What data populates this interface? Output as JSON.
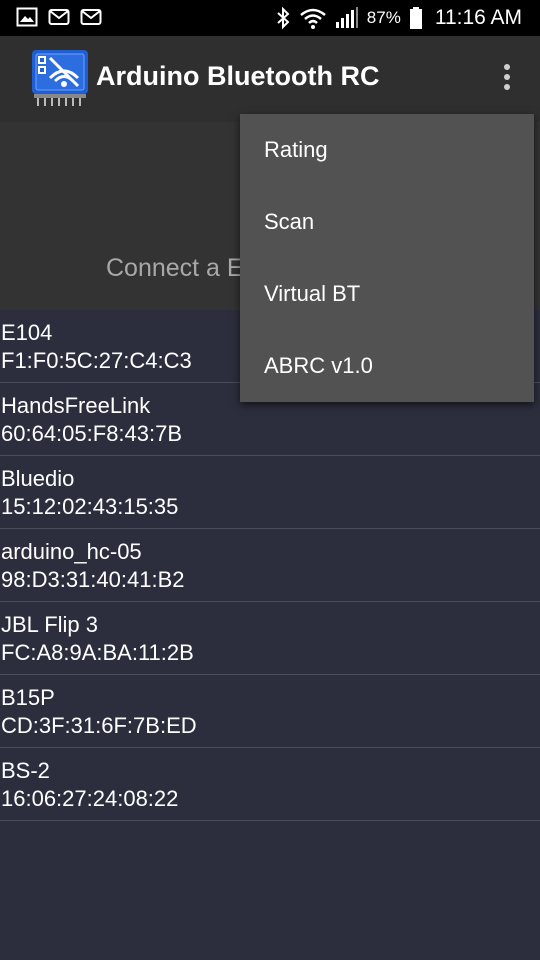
{
  "status_bar": {
    "battery_percent": "87%",
    "time": "11:16 AM",
    "left_icons": [
      "image-icon",
      "mail-icon",
      "mail-icon"
    ],
    "right_icons": [
      "bluetooth-icon",
      "wifi-icon",
      "signal-icon",
      "battery-icon"
    ]
  },
  "app_bar": {
    "title": "Arduino Bluetooth RC",
    "logo_icon": "arduino-bluetooth-logo",
    "menu_icon": "more-vertical-icon"
  },
  "header": {
    "connect_text": "Connect a E"
  },
  "devices": [
    {
      "name": "E104",
      "address": "F1:F0:5C:27:C4:C3"
    },
    {
      "name": "HandsFreeLink",
      "address": "60:64:05:F8:43:7B"
    },
    {
      "name": "Bluedio",
      "address": "15:12:02:43:15:35"
    },
    {
      "name": "arduino_hc-05",
      "address": "98:D3:31:40:41:B2"
    },
    {
      "name": "JBL Flip 3",
      "address": "FC:A8:9A:BA:11:2B"
    },
    {
      "name": "B15P",
      "address": "CD:3F:31:6F:7B:ED"
    },
    {
      "name": "BS-2",
      "address": "16:06:27:24:08:22"
    }
  ],
  "menu": {
    "items": [
      {
        "label": "Rating"
      },
      {
        "label": "Scan"
      },
      {
        "label": "Virtual BT"
      },
      {
        "label": "ABRC v1.0"
      }
    ]
  },
  "colors": {
    "background": "#2c2e3e",
    "app_bar": "#2f2f2f",
    "menu": "#525252",
    "logo_blue": "#1f5fd1"
  }
}
